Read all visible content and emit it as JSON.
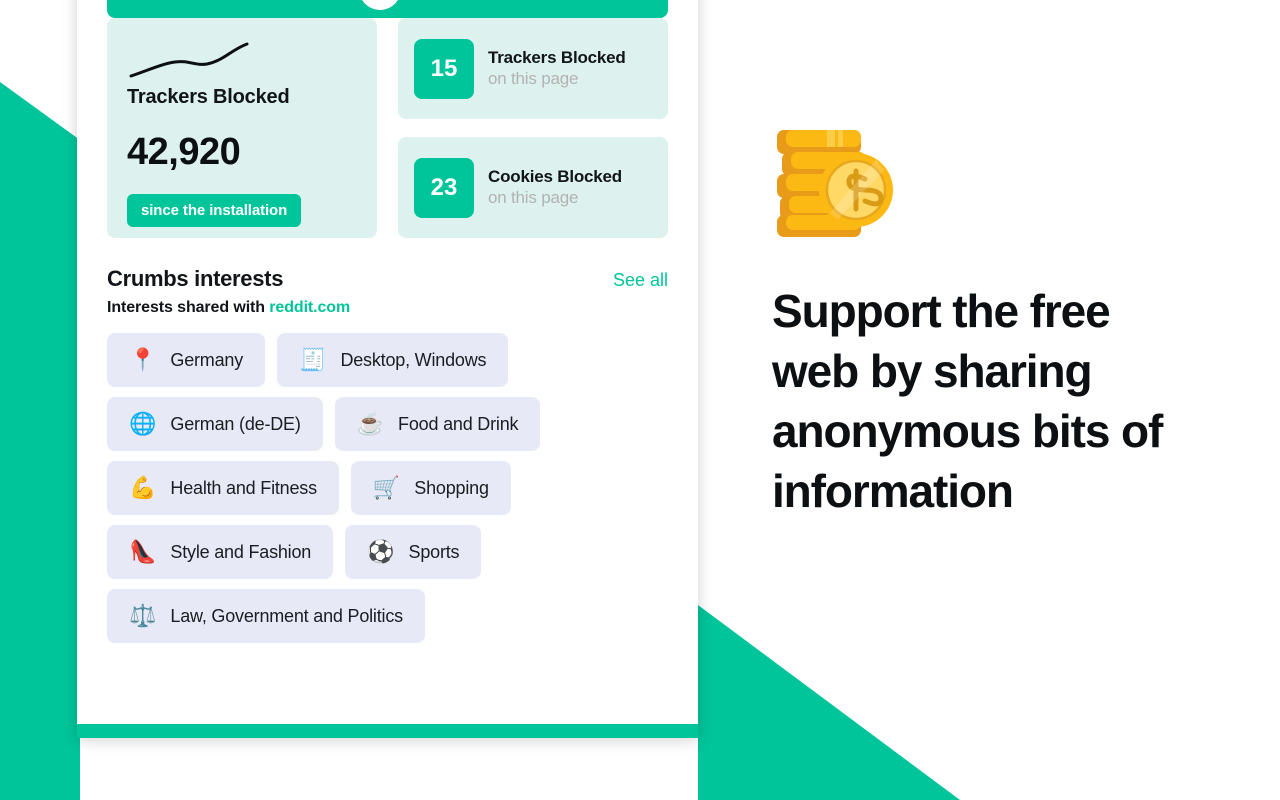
{
  "theme": {
    "brand_green": "#00c49a",
    "mint_card": "#ddf2ee",
    "chip_bg": "#e7eaf6",
    "muted_text": "#b2b2b2",
    "coin_gold": "#fcb813",
    "coin_gold_dark": "#e89b18",
    "coin_face": "#ffd866"
  },
  "card": {
    "header_avatar": "avatar-circle",
    "big_stat": {
      "sparkline_icon": "sparkline-trend-icon",
      "title": "Trackers Blocked",
      "value": "42,920",
      "pill_label": "since the installation"
    },
    "mini_stats": [
      {
        "count": "15",
        "title": "Trackers Blocked",
        "subtitle": "on this page"
      },
      {
        "count": "23",
        "title": "Cookies Blocked",
        "subtitle": "on this page"
      }
    ],
    "interests": {
      "title": "Crumbs interests",
      "see_all_label": "See all",
      "subtitle_prefix": "Interests shared with ",
      "subtitle_domain": "reddit.com",
      "chips": [
        {
          "emoji": "📍",
          "icon_name": "location-pin-icon",
          "label": "Germany"
        },
        {
          "emoji": "🧾",
          "icon_name": "receipt-icon",
          "label": "Desktop, Windows"
        },
        {
          "emoji": "🌐",
          "icon_name": "globe-icon",
          "label": "German (de-DE)"
        },
        {
          "emoji": "☕",
          "icon_name": "hot-beverage-icon",
          "label": "Food and Drink"
        },
        {
          "emoji": "💪",
          "icon_name": "flexed-biceps-icon",
          "label": "Health and Fitness"
        },
        {
          "emoji": "🛒",
          "icon_name": "shopping-cart-icon",
          "label": "Shopping"
        },
        {
          "emoji": "👠",
          "icon_name": "high-heel-icon",
          "label": "Style and Fashion"
        },
        {
          "emoji": "⚽",
          "icon_name": "soccer-ball-icon",
          "label": "Sports"
        },
        {
          "emoji": "⚖️",
          "icon_name": "balance-scale-icon",
          "label": "Law, Government and Politics"
        }
      ]
    }
  },
  "promo": {
    "icon_name": "coin-stack-icon",
    "title": "Support the free web by sharing anonymous bits of information"
  }
}
